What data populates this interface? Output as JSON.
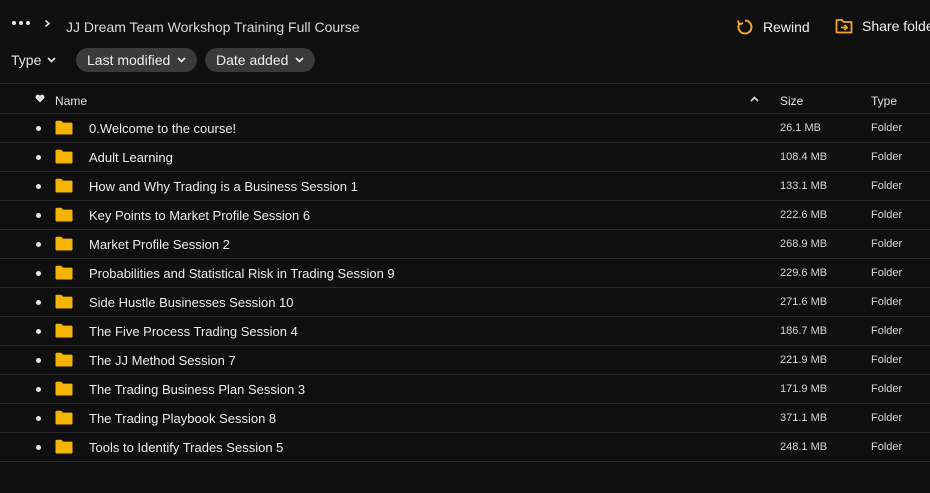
{
  "breadcrumb": {
    "title": "JJ Dream Team Workshop Training Full Course"
  },
  "actions": {
    "rewind_label": "Rewind",
    "share_label": "Share folde"
  },
  "filters": {
    "type_label": "Type",
    "last_modified_label": "Last modified",
    "date_added_label": "Date added"
  },
  "table": {
    "headers": {
      "name": "Name",
      "size": "Size",
      "type": "Type"
    },
    "rows": [
      {
        "name": "0.Welcome to the course!",
        "size": "26.1 MB",
        "type": "Folder"
      },
      {
        "name": "Adult Learning",
        "size": "108.4 MB",
        "type": "Folder"
      },
      {
        "name": "How and Why Trading is a Business Session 1",
        "size": "133.1 MB",
        "type": "Folder"
      },
      {
        "name": "Key Points to Market Profile Session 6",
        "size": "222.6 MB",
        "type": "Folder"
      },
      {
        "name": "Market Profile Session 2",
        "size": "268.9 MB",
        "type": "Folder"
      },
      {
        "name": "Probabilities and Statistical Risk in Trading Session 9",
        "size": "229.6 MB",
        "type": "Folder"
      },
      {
        "name": "Side Hustle Businesses Session 10",
        "size": "271.6 MB",
        "type": "Folder"
      },
      {
        "name": "The Five Process Trading Session 4",
        "size": "186.7 MB",
        "type": "Folder"
      },
      {
        "name": "The JJ Method Session 7",
        "size": "221.9 MB",
        "type": "Folder"
      },
      {
        "name": "The Trading Business Plan Session 3",
        "size": "171.9 MB",
        "type": "Folder"
      },
      {
        "name": "The Trading Playbook Session 8",
        "size": "371.1 MB",
        "type": "Folder"
      },
      {
        "name": "Tools to Identify Trades Session 5",
        "size": "248.1 MB",
        "type": "Folder"
      }
    ]
  },
  "colors": {
    "background": "#0f0f0f",
    "accent_orange": "#f5a623",
    "folder_yellow": "#f4b400",
    "pill_bg": "#3a3a3a"
  },
  "icons": {
    "more": "more-dots-icon",
    "chevron": "chevron-right-icon",
    "rewind": "rewind-icon",
    "share": "share-folder-icon",
    "favorite": "heart-icon",
    "sort": "sort-up-icon",
    "folder": "folder-icon"
  }
}
